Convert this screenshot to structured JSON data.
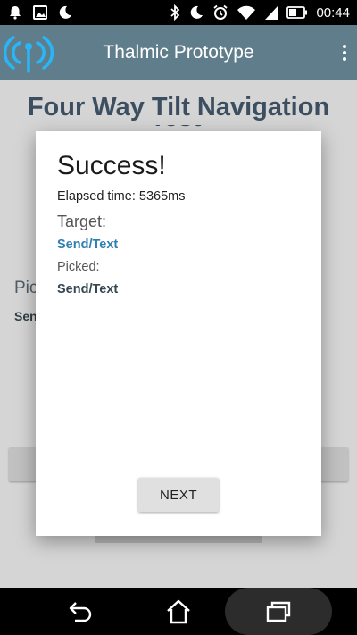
{
  "status_bar": {
    "time": "00:44",
    "left_icons": [
      "notification-bell-icon",
      "image-icon",
      "moon-icon"
    ],
    "right_icons": [
      "bluetooth-icon",
      "moon-icon",
      "alarm-icon",
      "wifi-icon",
      "signal-icon",
      "battery-icon"
    ]
  },
  "app_bar": {
    "title": "Thalmic Prototype",
    "logo_icon": "signal-antenna-logo-icon",
    "menu_icon": "overflow-menu-icon",
    "color": "#607d8b"
  },
  "background": {
    "page_title": "Four Way Tilt Navigation",
    "page_title_line2": "Test",
    "picked_label": "Picked:",
    "picked_value": "Send/Text"
  },
  "dialog": {
    "title": "Success!",
    "elapsed": "Elapsed time: 5365ms",
    "target_label": "Target:",
    "target_value": "Send/Text",
    "picked_label": "Picked:",
    "picked_value": "Send/Text",
    "next_label": "NEXT",
    "target_color": "#2e7fb2"
  },
  "nav_bar": {
    "icons": [
      "back-icon",
      "home-icon",
      "recent-apps-icon"
    ]
  }
}
